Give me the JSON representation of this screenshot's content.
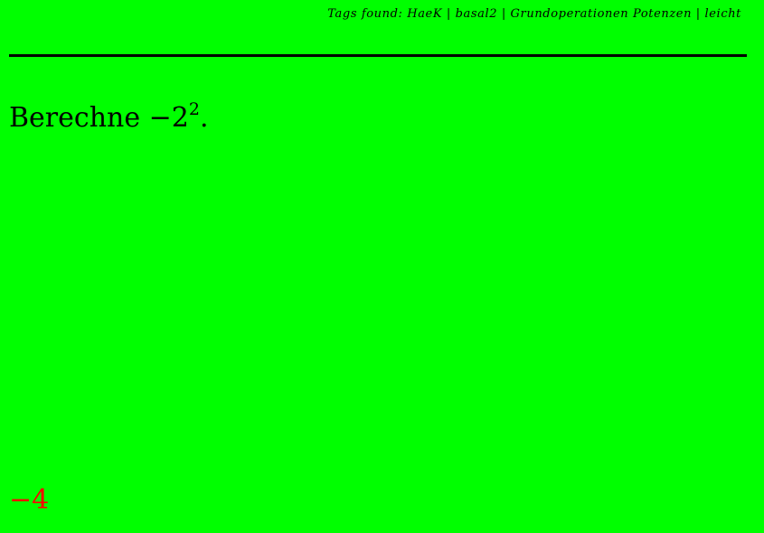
{
  "colors": {
    "background": "#00ff00",
    "text": "#000000",
    "rule": "#000000",
    "answer": "#ff0000"
  },
  "header": {
    "tags_text": "Tags found: HaeK | basal2 | Grundoperationen Potenzen | leicht"
  },
  "question": {
    "prefix": "Berechne ",
    "base": "−2",
    "exponent": "2",
    "suffix": "."
  },
  "answer": {
    "value": "−4"
  }
}
